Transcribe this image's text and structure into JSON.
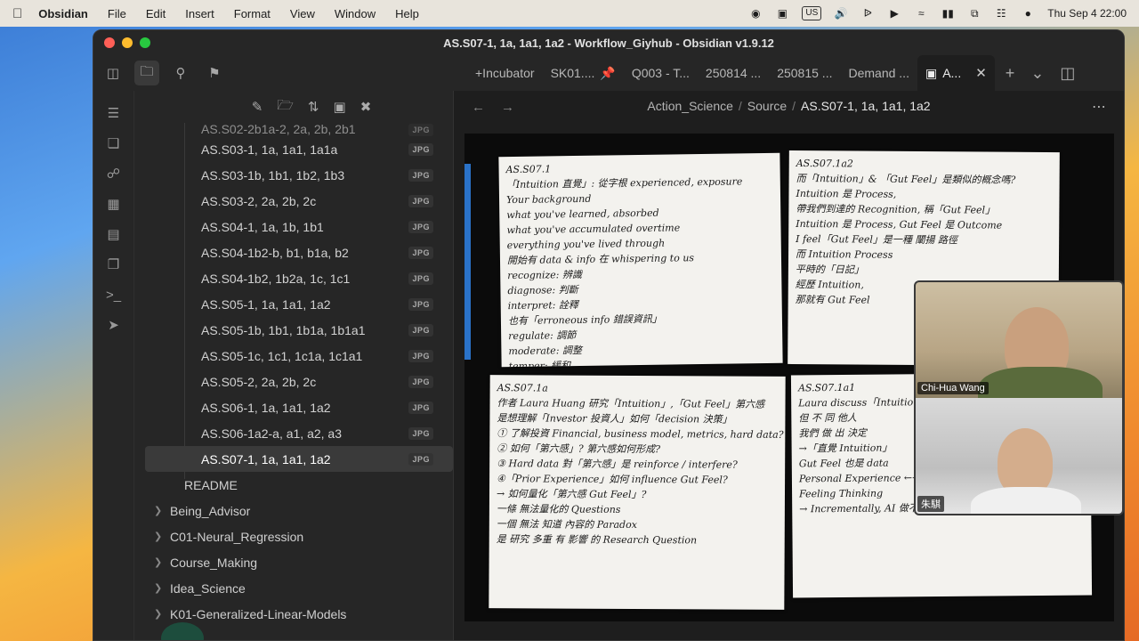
{
  "menubar": {
    "app_name": "Obsidian",
    "menus": [
      "File",
      "Edit",
      "Insert",
      "Format",
      "View",
      "Window",
      "Help"
    ],
    "input_source": "US",
    "clock": "Thu Sep 4  22:00"
  },
  "window": {
    "title": "AS.S07-1, 1a, 1a1, 1a2 - Workflow_Giyhub - Obsidian v1.9.12"
  },
  "tabs": [
    {
      "label": "+Incubator",
      "pinned": false,
      "active": false
    },
    {
      "label": "SK01....",
      "pinned": true,
      "active": false
    },
    {
      "label": "Q003 - T...",
      "pinned": false,
      "active": false
    },
    {
      "label": "250814 ...",
      "pinned": false,
      "active": false
    },
    {
      "label": "250815 ...",
      "pinned": false,
      "active": false
    },
    {
      "label": "Demand ...",
      "pinned": false,
      "active": false
    },
    {
      "label": "A...",
      "pinned": false,
      "active": true
    }
  ],
  "breadcrumb": {
    "part1": "Action_Science",
    "part2": "Source",
    "current": "AS.S07-1, 1a, 1a1, 1a2",
    "separator": "/"
  },
  "files": [
    {
      "name": "AS.S02-2b1a-2, 2a, 2b, 2b1",
      "badge": "JPG",
      "partial": true
    },
    {
      "name": "AS.S03-1, 1a, 1a1, 1a1a",
      "badge": "JPG"
    },
    {
      "name": "AS.S03-1b, 1b1, 1b2, 1b3",
      "badge": "JPG"
    },
    {
      "name": "AS.S03-2, 2a, 2b, 2c",
      "badge": "JPG"
    },
    {
      "name": "AS.S04-1, 1a, 1b, 1b1",
      "badge": "JPG"
    },
    {
      "name": "AS.S04-1b2-b, b1, b1a, b2",
      "badge": "JPG"
    },
    {
      "name": "AS.S04-1b2, 1b2a, 1c, 1c1",
      "badge": "JPG"
    },
    {
      "name": "AS.S05-1, 1a, 1a1, 1a2",
      "badge": "JPG"
    },
    {
      "name": "AS.S05-1b, 1b1, 1b1a, 1b1a1",
      "badge": "JPG"
    },
    {
      "name": "AS.S05-1c, 1c1, 1c1a, 1c1a1",
      "badge": "JPG"
    },
    {
      "name": "AS.S05-2, 2a, 2b, 2c",
      "badge": "JPG"
    },
    {
      "name": "AS.S06-1, 1a, 1a1, 1a2",
      "badge": "JPG"
    },
    {
      "name": "AS.S06-1a2-a, a1, a2, a3",
      "badge": "JPG"
    },
    {
      "name": "AS.S07-1, 1a, 1a1, 1a2",
      "badge": "JPG",
      "selected": true
    }
  ],
  "readme": "README",
  "folders": [
    "Being_Advisor",
    "C01-Neural_Regression",
    "Course_Making",
    "Idea_Science",
    "K01-Generalized-Linear-Models"
  ],
  "notes": {
    "tl": {
      "title": "AS.S07.1",
      "lines": [
        "「Intuition 直覺」: 從字根 experienced, exposure",
        "  Your background",
        "  what you've learned, absorbed",
        "  what you've accumulated overtime",
        "  everything you've lived through",
        "開始有 data & info 在 whispering to us",
        "  recognize: 辨識",
        "  diagnose: 判斷",
        "  interpret: 詮釋",
        "也有「erroneous info 錯誤資訊」",
        "  regulate: 調節",
        "  moderate: 調整",
        "  temper: 緩和"
      ]
    },
    "tr": {
      "title": "AS.S07.1a2",
      "lines": [
        "而「Intuition」& 「Gut Feel」是類似的概念嗎?",
        "  Intuition 是 Process,",
        "  帶我們到達的 Recognition, 稱「Gut Feel」",
        "Intuition 是 Process, Gut Feel 是 Outcome",
        "  I feel「Gut Feel」是一種 闡揚 路徑",
        "而 Intuition Process",
        "平時的「日記」",
        "經歷 Intuition,",
        "那就有 Gut Feel"
      ]
    },
    "bl": {
      "title": "AS.S07.1a",
      "lines": [
        "作者 Laura Huang 研究「Intuition」,「Gut Feel」第六感",
        "是想理解「Investor 投資人」如何「decision 決策」",
        "① 了解投資 Financial, business model, metrics, hard data?",
        "② 如何「第六感」? 第六感如何形成?",
        "③ Hard data 對「第六感」是 reinforce / interfere?",
        "④「Prior Experience」如何 influence Gut Feel?",
        "→ 如何量化「第六感 Gut Feel」?",
        "  一條 無法量化的 Questions",
        "  一個 無法 知道 內容的 Paradox",
        "是 研究 多重 有 影響 的 Research Question"
      ]
    },
    "br": {
      "title": "AS.S07.1a1",
      "lines": [
        "Laura discuss「Intuition」",
        "  但 不 同 他人",
        "  我們 做 出 決定",
        "→「直覺 Intuition」",
        "Gut Feel 也是 data",
        "Personal Experience ←→ Biased Data → Outcome",
        "  Feeling          Thinking",
        "→ Incrementally, AI 做不到 是 Thinking Machine"
      ]
    }
  },
  "video": {
    "participants": [
      {
        "name": "Chi-Hua Wang"
      },
      {
        "name": "朱騏"
      }
    ]
  }
}
